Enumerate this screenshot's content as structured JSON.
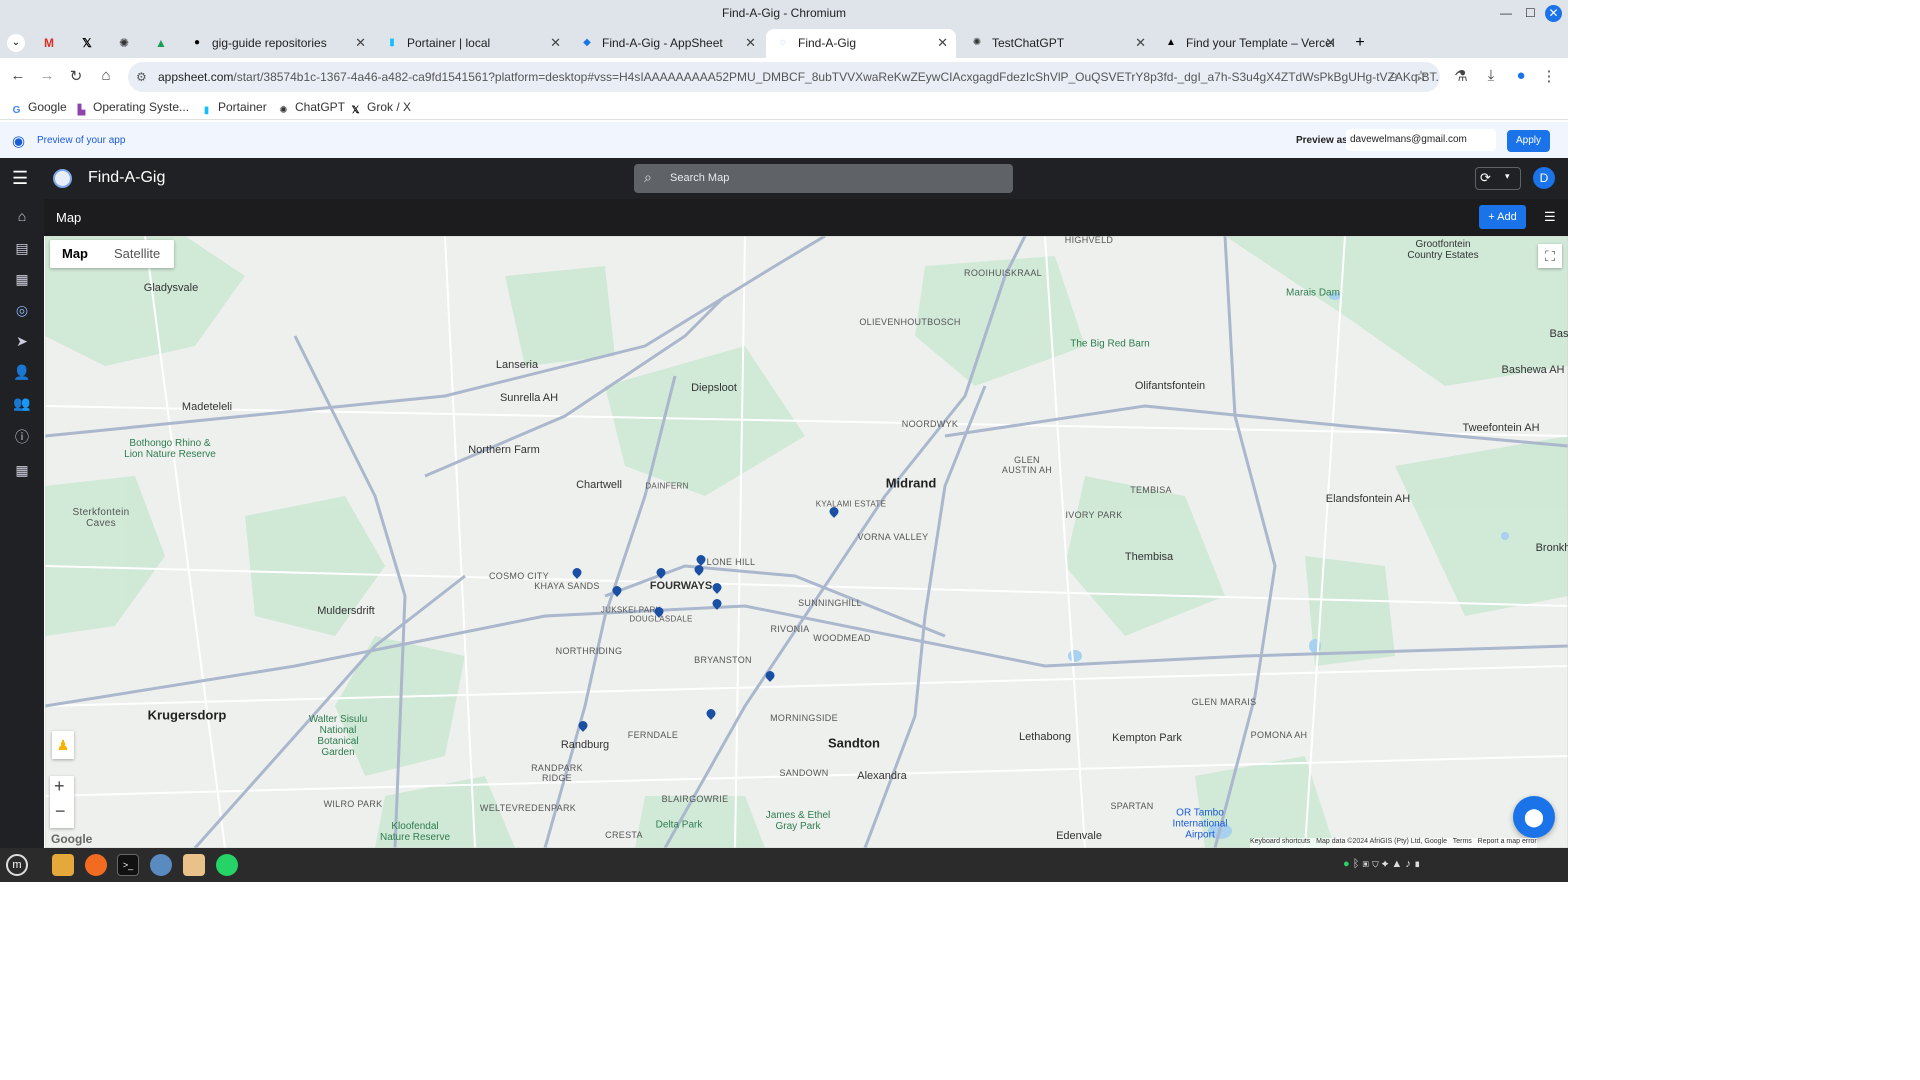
{
  "window": {
    "title": "Find-A-Gig - Chromium"
  },
  "tabs": [
    {
      "label": "gig-guide repositories",
      "icon": "github-icon"
    },
    {
      "label": "Portainer | local",
      "icon": "portainer-icon"
    },
    {
      "label": "Find-A-Gig - AppSheet",
      "icon": "appsheet-icon"
    },
    {
      "label": "Find-A-Gig",
      "icon": "find-a-gig-icon",
      "active": true
    },
    {
      "label": "TestChatGPT",
      "icon": "chatgpt-icon"
    },
    {
      "label": "Find your Template – Vercel",
      "icon": "vercel-icon"
    }
  ],
  "address": {
    "host": "appsheet.com",
    "path": "/start/38574b1c-1367-4a46-a482-ca9fd1541561?platform=desktop#vss=H4sIAAAAAAAAA52PMU_DMBCF_8ubTVVXwaReKwZEywCIAcxgagdFdezIcShVlP_OuQSVETrY8p3fd-_dgI_a7h-S3u4gX4ZTdWsPkBgUHg-tVZAKq-BT..."
  },
  "bookmarks": [
    {
      "label": "Google",
      "icon": "google-icon"
    },
    {
      "label": "Operating Syste...",
      "icon": "bookmark-icon"
    },
    {
      "label": "Portainer",
      "icon": "portainer-icon"
    },
    {
      "label": "ChatGPT",
      "icon": "chatgpt-icon"
    },
    {
      "label": "Grok / X",
      "icon": "x-icon"
    }
  ],
  "preview": {
    "label": "Preview of your app",
    "preview_as_label": "Preview as:",
    "email": "davewelmans@gmail.com",
    "apply_label": "Apply"
  },
  "app": {
    "name": "Find-A-Gig",
    "search_placeholder": "Search Map",
    "avatar_initial": "D",
    "view_title": "Map",
    "add_label": "Add"
  },
  "map": {
    "map_type_map": "Map",
    "map_type_satellite": "Satellite",
    "attribution_keyboard": "Keyboard shortcuts",
    "attribution_data": "Map data ©2024 AfriGIS (Pty) Ltd, Google",
    "attribution_terms": "Terms",
    "attribution_report": "Report a map error",
    "google_logo": "Google",
    "places": {
      "midrand": "Midrand",
      "sandton": "Sandton",
      "krugersdorp": "Krugersdorp",
      "randburg": "Randburg",
      "lanseria": "Lanseria",
      "diepsloot": "Diepsloot",
      "fourways": "FOURWAYS",
      "olifantsfontein": "Olifantsfontein",
      "alexandra": "Alexandra",
      "muldersdrift": "Muldersdrift",
      "gladysvale": "Gladysvale",
      "madeteleli": "Madeteleli",
      "sunrella": "Sunrella AH",
      "northern_farm": "Northern Farm",
      "chartwell": "Chartwell",
      "bryanston": "BRYANSTON",
      "lethabong": "Lethabong",
      "kempton_park": "Kempton Park",
      "edenvale": "Edenvale",
      "thembisa": "Thembisa",
      "tembisa": "TEMBISA",
      "ivory_park": "IVORY PARK",
      "vorna_valley": "VORNA VALLEY",
      "noordwyk": "NOORDWYK",
      "lone_hill": "LONE HILL",
      "sunninghill": "SUNNINGHILL",
      "woodmead": "WOODMEAD",
      "rivonia": "RIVONIA",
      "northriding": "NORTHRIDING",
      "ferndale": "FERNDALE",
      "cosmo_city": "COSMO CITY",
      "khaya_sands": "KHAYA SANDS",
      "morningside": "MORNINGSIDE",
      "sandown": "SANDOWN",
      "olievenhoutbosch": "OLIEVENHOUTBOSCH",
      "highveld": "HIGHVELD",
      "rooihuiskraal": "ROOIHUISKRAAL",
      "randpark_ridge": "RANDPARK\nRIDGE",
      "wilro_park": "WILRO PARK",
      "weltevredenpark": "WELTEVREDENPARK",
      "blairgowrie": "BLAIRGOWRIE",
      "glen_marais": "GLEN MARAIS",
      "pomona": "POMONA AH",
      "spartan": "SPARTAN",
      "tweefontein": "Tweefontein AH",
      "elandsfontein": "Elandsfontein AH",
      "bashewa": "Bashewa AH",
      "grootfontein": "Grootfontein\nCountry Estates",
      "big_red_barn": "The Big Red Barn",
      "marais_dam": "Marais Dam",
      "bothongo": "Bothongo Rhino &\nLion Nature Reserve",
      "sterkfontein": "Sterkfontein\nCaves",
      "walter_sisulu": "Walter Sisulu\nNational\nBotanical\nGarden",
      "delta_park": "Delta Park",
      "james_ethel": "James & Ethel\nGray Park",
      "kloofendal": "Kloofendal\nNature Reserve",
      "or_tambo": "OR Tambo\nInternational\nAirport",
      "glen_austin": "GLEN\nAUSTIN AH",
      "kyalami_estate": "KYALAMI ESTATE",
      "bronkh": "Bronkh",
      "bas": "Bas",
      "cresta": "CRESTA",
      "dainfern": "DAINFERN",
      "douglasdale": "DOUGLASDALE",
      "jukskei_park": "JUKSKEI PARK"
    }
  }
}
